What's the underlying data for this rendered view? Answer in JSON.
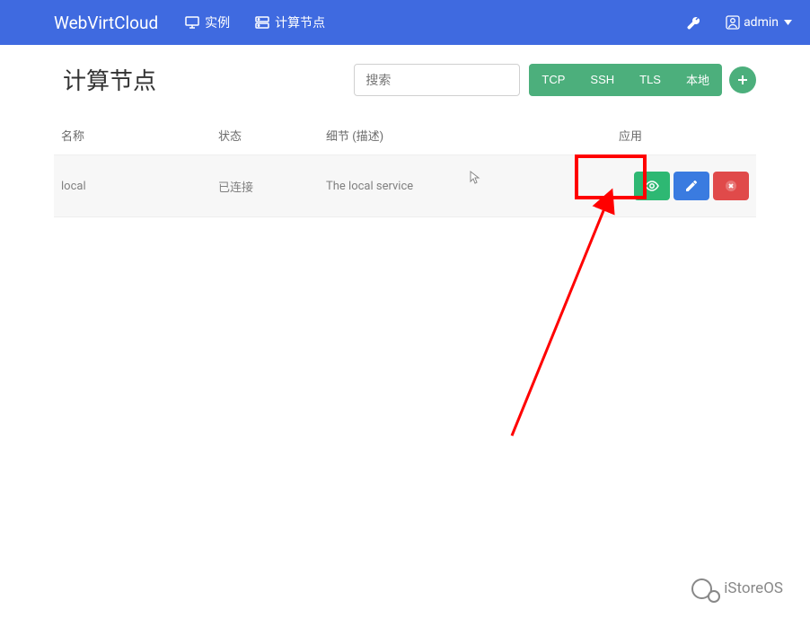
{
  "brand": "WebVirtCloud",
  "nav": {
    "instances": "实例",
    "nodes": "计算节点"
  },
  "user": {
    "name": "admin"
  },
  "page": {
    "title": "计算节点"
  },
  "search": {
    "placeholder": "搜索"
  },
  "tabs": {
    "tcp": "TCP",
    "ssh": "SSH",
    "tls": "TLS",
    "local": "本地"
  },
  "table": {
    "headers": {
      "name": "名称",
      "status": "状态",
      "detail": "细节 (描述)",
      "action": "应用"
    },
    "rows": [
      {
        "name": "local",
        "status": "已连接",
        "detail": "The local service"
      }
    ]
  },
  "watermark": {
    "text": "iStoreOS"
  }
}
